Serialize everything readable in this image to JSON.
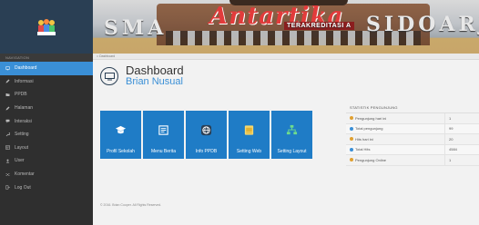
{
  "sidebar": {
    "heading": "NAVIGATION",
    "items": [
      {
        "label": "Dashboard",
        "icon": "monitor-icon",
        "active": true
      },
      {
        "label": "Informasi",
        "icon": "pencil-icon",
        "active": false
      },
      {
        "label": "PPDB",
        "icon": "folder-icon",
        "active": false
      },
      {
        "label": "Halaman",
        "icon": "pencil-icon",
        "active": false
      },
      {
        "label": "Interaksi",
        "icon": "chat-icon",
        "active": false
      },
      {
        "label": "Setting",
        "icon": "wrench-icon",
        "active": false
      },
      {
        "label": "Layout",
        "icon": "layout-icon",
        "active": false
      },
      {
        "label": "User",
        "icon": "user-icon",
        "active": false
      },
      {
        "label": "Komentar",
        "icon": "shuffle-icon",
        "active": false
      },
      {
        "label": "Log Out",
        "icon": "logout-icon",
        "active": false
      }
    ]
  },
  "banner": {
    "sma": "SMA",
    "antartika": "Antartika",
    "terakreditasi": "TERAKREDITASI A",
    "sidoarjo": "SIDOARJO"
  },
  "breadcrumb": "Dashboard",
  "header": {
    "title": "Dashboard",
    "subtitle": "Brian Nusual"
  },
  "tiles": [
    {
      "label": "Profil Sekolah",
      "icon": "graduation-cap-icon"
    },
    {
      "label": "Menu Berita",
      "icon": "news-icon"
    },
    {
      "label": "Info PPDB",
      "icon": "globe-icon"
    },
    {
      "label": "Setting Web",
      "icon": "browser-icon"
    },
    {
      "label": "Setting Layout",
      "icon": "sitemap-icon"
    }
  ],
  "stats": {
    "title": "STATISTIK PENGUNJUNG",
    "rows": [
      {
        "label": "Pengunjung hari ini",
        "value": "1",
        "color": "#e0a030"
      },
      {
        "label": "Total pengunjung",
        "value": "99",
        "color": "#3a8fd6"
      },
      {
        "label": "Hits hari ini",
        "value": "20",
        "color": "#e0a030"
      },
      {
        "label": "Total Hits",
        "value": "4584",
        "color": "#3a8fd6"
      },
      {
        "label": "Pengunjung Online",
        "value": "1",
        "color": "#e0a030"
      }
    ]
  },
  "footer": "© 2016. Brian Cooper. All Rights Reserved.",
  "colors": {
    "accent": "#3a8fd6",
    "tile": "#1f7cc6",
    "sidebar": "#2f2f2f"
  }
}
